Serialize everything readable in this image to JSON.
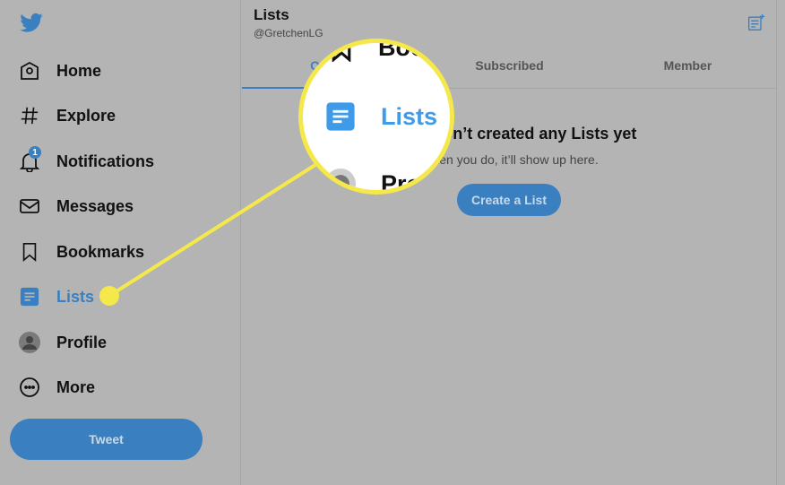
{
  "sidebar": {
    "logo": "twitter-bird-icon",
    "items": [
      {
        "label": "Home",
        "icon": "home-icon"
      },
      {
        "label": "Explore",
        "icon": "hashtag-icon"
      },
      {
        "label": "Notifications",
        "icon": "bell-icon",
        "badge": "1"
      },
      {
        "label": "Messages",
        "icon": "envelope-icon"
      },
      {
        "label": "Bookmarks",
        "icon": "bookmark-icon"
      },
      {
        "label": "Lists",
        "icon": "lists-icon",
        "active": true
      },
      {
        "label": "Profile",
        "icon": "avatar-icon"
      },
      {
        "label": "More",
        "icon": "more-icon"
      }
    ],
    "tweet_label": "Tweet"
  },
  "header": {
    "title": "Lists",
    "handle": "@GretchenLG"
  },
  "tabs": [
    {
      "label": "Owned"
    },
    {
      "label": "Subscribed"
    },
    {
      "label": "Member"
    }
  ],
  "empty": {
    "heading": "You haven’t created any Lists yet",
    "sub": "When you do, it’ll show up here.",
    "button": "Create a List"
  },
  "magnifier": {
    "top": "Boo",
    "center": "Lists",
    "bottom": "Pro"
  },
  "colors": {
    "accent": "#3a80c0",
    "highlight": "#f5e84a",
    "background": "#b4b4b4"
  }
}
